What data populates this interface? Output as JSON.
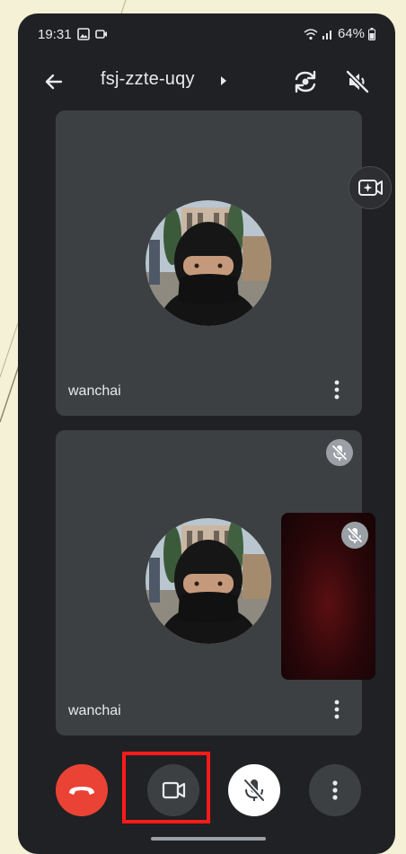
{
  "status_bar": {
    "time": "19:31",
    "battery": "64%"
  },
  "app_bar": {
    "meeting_code": "fsj-zzte-uqy"
  },
  "participants": [
    {
      "name": "wanchai"
    },
    {
      "name": "wanchai"
    }
  ],
  "icons": {
    "back": "arrow-left-icon",
    "switch_camera": "switch-camera-icon",
    "speaker": "speaker-muted-icon",
    "effects": "effects-icon",
    "more": "more-vert-icon",
    "end_call": "hang-up-icon",
    "camera": "video-camera-icon",
    "mic": "mic-off-icon"
  },
  "colors": {
    "background": "#202124",
    "tile": "#3c4043",
    "end_call": "#ea4335",
    "highlight": "#ff1a1a"
  }
}
